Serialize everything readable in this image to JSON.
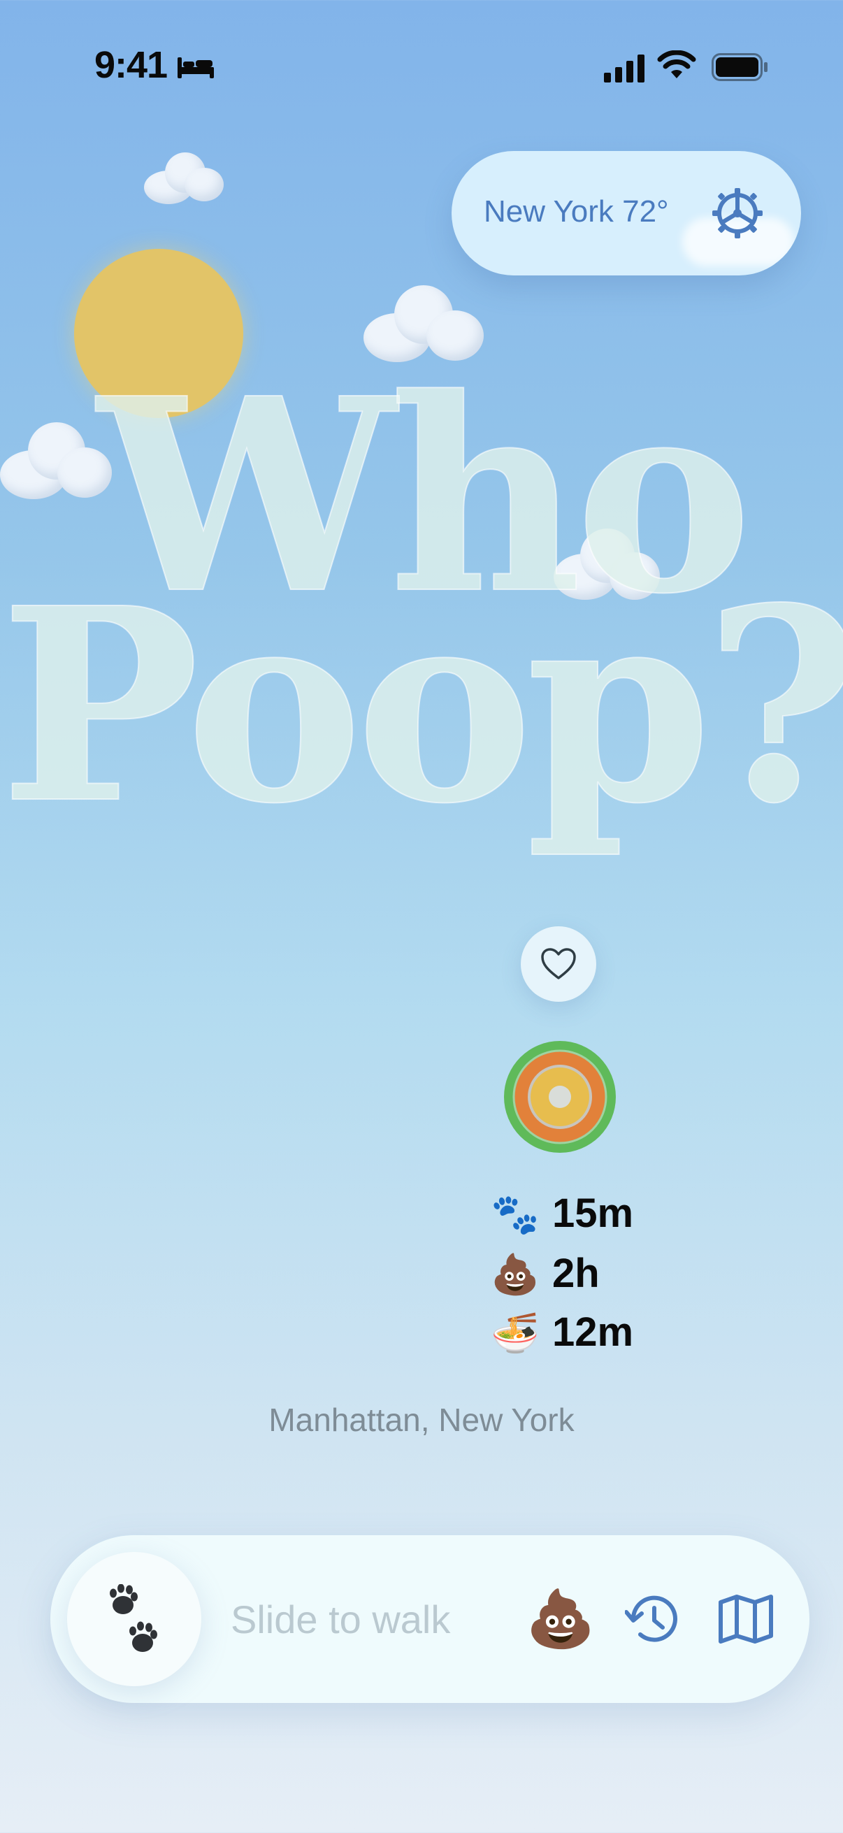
{
  "status_bar": {
    "time": "9:41"
  },
  "weather": {
    "label": "New York 72°"
  },
  "title": {
    "line1": "Who",
    "line2": "Poop?"
  },
  "stats": [
    {
      "icon": "🐾",
      "value": "15m"
    },
    {
      "icon": "💩",
      "value": "2h"
    },
    {
      "icon": "🍜",
      "value": "12m"
    }
  ],
  "location": "Manhattan, New York",
  "bottom_bar": {
    "slide_label": "Slide to walk",
    "poop_emoji": "💩"
  },
  "colors": {
    "accent": "#4a7bbf",
    "ring_outer": "#5fba5a",
    "ring_middle": "#e2813a",
    "ring_inner": "#e7bd4e"
  }
}
